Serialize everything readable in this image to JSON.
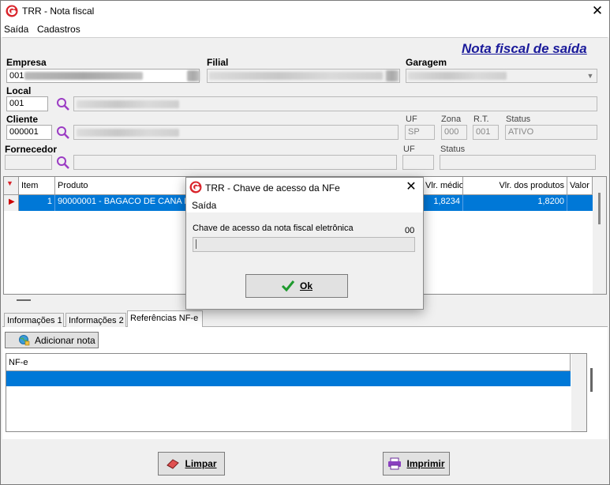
{
  "window": {
    "title": "TRR - Nota fiscal"
  },
  "menu": {
    "items": [
      "Saída",
      "Cadastros"
    ]
  },
  "header": {
    "title": "Nota fiscal de saída"
  },
  "empresa": {
    "label": "Empresa",
    "code": "001"
  },
  "filial": {
    "label": "Filial"
  },
  "garagem": {
    "label": "Garagem"
  },
  "local": {
    "label": "Local",
    "code": "001"
  },
  "cliente": {
    "label": "Cliente",
    "code": "000001",
    "uf_label": "UF",
    "uf": "SP",
    "zona_label": "Zona",
    "zona": "000",
    "rt_label": "R.T.",
    "rt": "001",
    "status_label": "Status",
    "status": "ATIVO"
  },
  "fornecedor": {
    "label": "Fornecedor",
    "uf_label": "UF",
    "status_label": "Status"
  },
  "grid": {
    "columns": [
      "Item",
      "Produto",
      "Vlr. médio",
      "Vlr. dos produtos",
      "Valor"
    ],
    "rows": [
      {
        "item": "1",
        "produto": "90000001 - BAGACO DE CANA D",
        "vlr_medio": "1,8234",
        "vlr_produtos": "1,8200"
      }
    ]
  },
  "tabs": [
    "Informações 1",
    "Informações 2",
    "Referências NF-e"
  ],
  "add_note_button": "Adicionar nota",
  "nfe_grid": {
    "column": "NF-e"
  },
  "buttons": {
    "limpar": "Limpar",
    "imprimir": "Imprimir"
  },
  "dialog": {
    "title": "TRR - Chave de acesso da NFe",
    "subtitle": "Saída",
    "field_label": "Chave de acesso da nota fiscal eletrônica",
    "counter": "00",
    "value": "",
    "ok_label": "Ok"
  },
  "colors": {
    "selection": "#0078d7",
    "header_title": "#1a1a9a",
    "app_logo": "#d9232a"
  }
}
